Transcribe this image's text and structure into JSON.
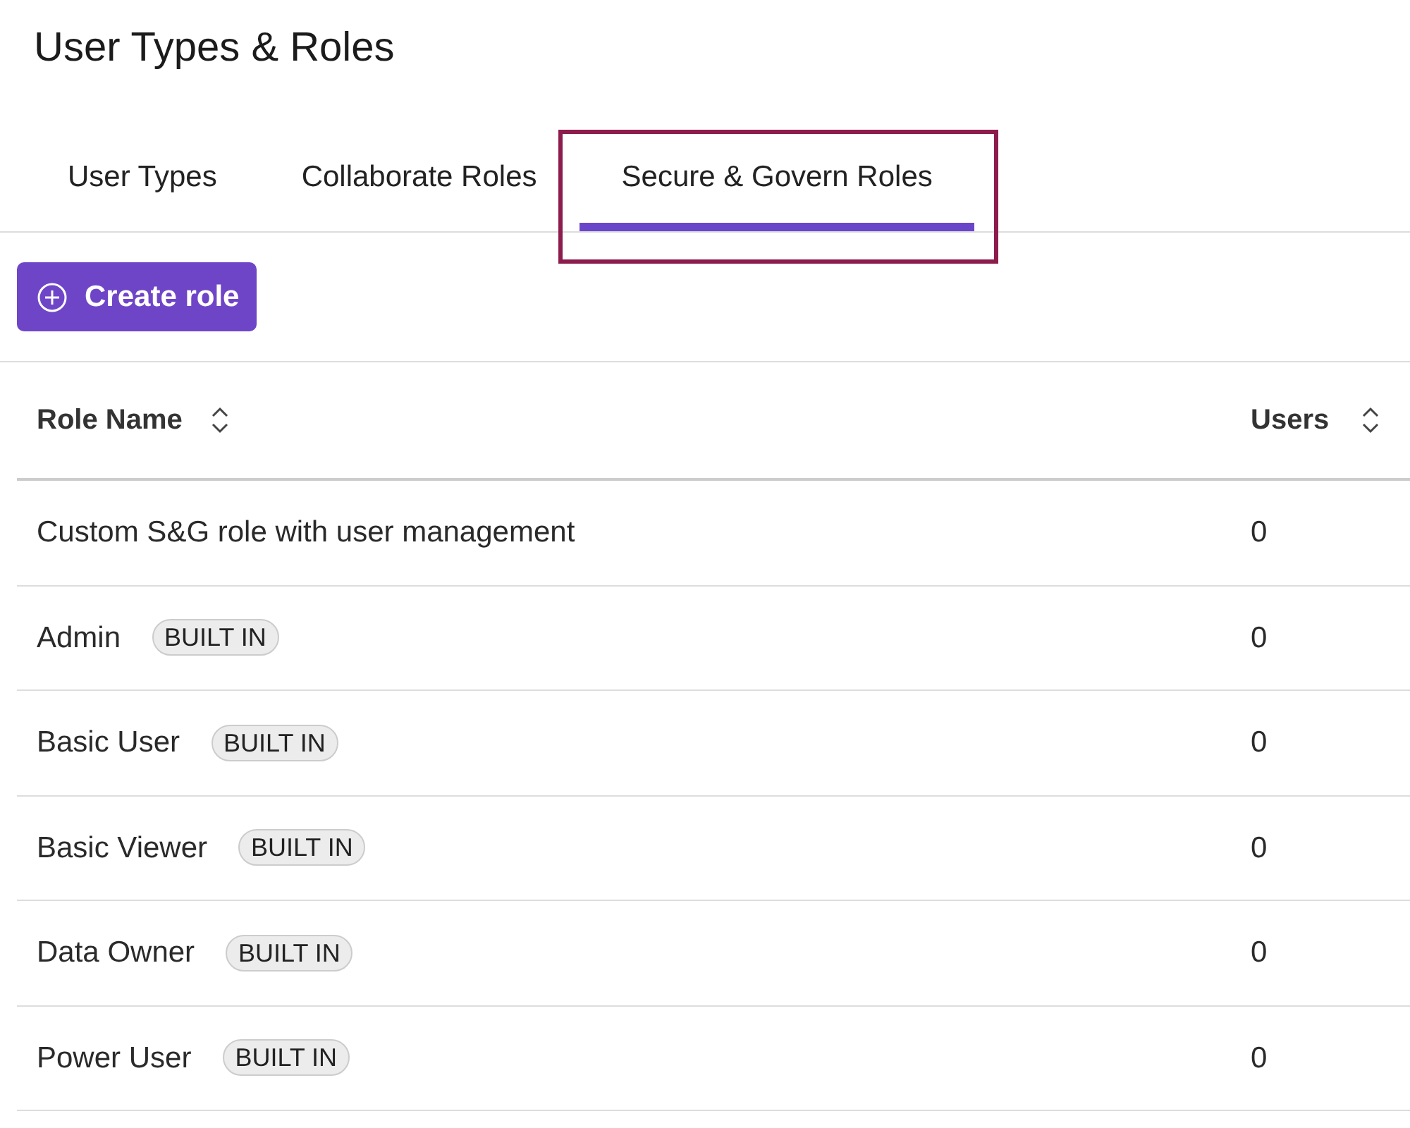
{
  "page": {
    "title": "User Types & Roles"
  },
  "tabs": [
    {
      "label": "User Types",
      "selected": false,
      "highlighted": false
    },
    {
      "label": "Collaborate Roles",
      "selected": false,
      "highlighted": false
    },
    {
      "label": "Secure & Govern Roles",
      "selected": true,
      "highlighted": true
    }
  ],
  "create_button": {
    "label": "Create role"
  },
  "table": {
    "columns": [
      {
        "label": "Role Name",
        "sortable": true
      },
      {
        "label": "Users",
        "sortable": true
      }
    ],
    "rows": [
      {
        "name": "Custom S&G role with user management",
        "users": "0"
      },
      {
        "name": "Admin",
        "badge": "BUILT IN",
        "users": "0"
      },
      {
        "name": "Basic User",
        "badge": "BUILT IN",
        "users": "0"
      },
      {
        "name": "Basic Viewer",
        "badge": "BUILT IN",
        "users": "0"
      },
      {
        "name": "Data Owner",
        "badge": "BUILT IN",
        "users": "0"
      },
      {
        "name": "Power User",
        "badge": "BUILT IN",
        "users": "0"
      }
    ]
  }
}
